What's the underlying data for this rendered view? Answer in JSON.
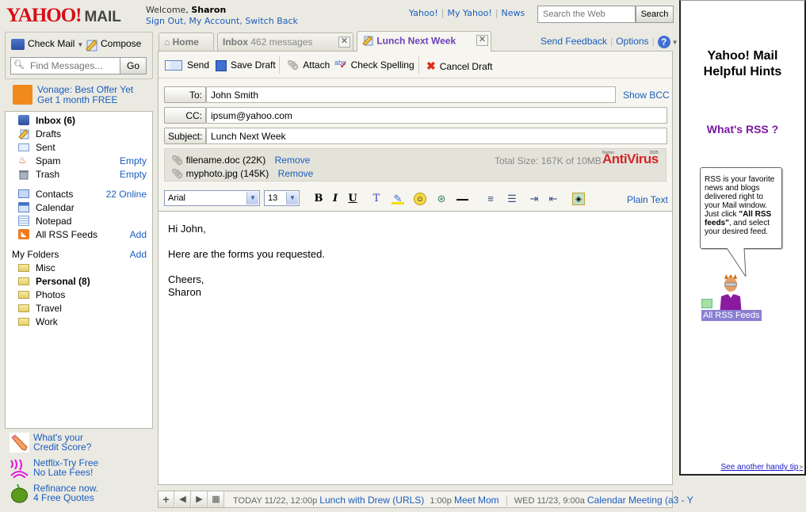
{
  "header": {
    "logo": "YAHOO!",
    "logo_suffix": "MAIL",
    "welcome_prefix": "Welcome, ",
    "user_name": "Sharon",
    "account_links": "Sign Out, My Account, Switch Back",
    "top_links": [
      "Yahoo!",
      "My Yahoo!",
      "News"
    ],
    "search_placeholder": "Search the Web",
    "search_button": "Search"
  },
  "left": {
    "check_mail": "Check Mail",
    "compose": "Compose",
    "find_placeholder": "Find Messages...",
    "go": "Go",
    "promo_line1": "Vonage: Best Offer Yet",
    "promo_line2": "Get 1 month FREE",
    "folders": [
      {
        "label": "Inbox (6)",
        "bold": true,
        "action": "",
        "icon": "inbox-icon"
      },
      {
        "label": "Drafts",
        "action": "",
        "icon": "drafts-icon"
      },
      {
        "label": "Sent",
        "action": "",
        "icon": "sent-icon"
      },
      {
        "label": "Spam",
        "action": "Empty",
        "icon": "spam-icon"
      },
      {
        "label": "Trash",
        "action": "Empty",
        "icon": "trash-icon"
      },
      {
        "label": "Contacts",
        "action": "22 Online",
        "icon": "contacts-icon"
      },
      {
        "label": "Calendar",
        "action": "",
        "icon": "calendar-icon"
      },
      {
        "label": "Notepad",
        "action": "",
        "icon": "notepad-icon"
      },
      {
        "label": "All RSS Feeds",
        "action": "Add",
        "icon": "rss-icon"
      }
    ],
    "my_folders_label": "My Folders",
    "my_folders_action": "Add",
    "my_folders": [
      {
        "label": "Misc"
      },
      {
        "label": "Personal (8)",
        "bold": true
      },
      {
        "label": "Photos"
      },
      {
        "label": "Travel"
      },
      {
        "label": "Work"
      }
    ],
    "ads": [
      {
        "line1": "What's your",
        "line2": "Credit Score?"
      },
      {
        "line1": "Netflix-Try Free",
        "line2": "No Late Fees!"
      },
      {
        "line1": "Refinance now.",
        "line2": "4 Free Quotes"
      }
    ]
  },
  "tabs": {
    "home": "Home",
    "inbox": "Inbox",
    "inbox_count": "462 messages",
    "compose": "Lunch Next Week",
    "close": "✕"
  },
  "top_right": {
    "feedback": "Send Feedback",
    "options": "Options",
    "help": "?"
  },
  "toolbar": {
    "send": "Send",
    "save_draft": "Save Draft",
    "attach": "Attach",
    "check_spelling": "Check Spelling",
    "cancel_draft": "Cancel Draft"
  },
  "compose": {
    "to_label": "To:",
    "to_value": "John Smith",
    "cc_label": "CC:",
    "cc_value": "ipsum@yahoo.com",
    "subject_label": "Subject:",
    "subject_value": "Lunch Next Week",
    "show_bcc": "Show BCC",
    "attachments": [
      {
        "name": "filename.doc (22K)",
        "action": "Remove"
      },
      {
        "name": "myphoto.jpg (145K)",
        "action": "Remove"
      }
    ],
    "total_size": "Total Size: 167K of 10MB",
    "antivirus_brand": "AntiVirus",
    "antivirus_small": "Norton",
    "antivirus_year": "2005",
    "font_family": "Arial",
    "font_size": "13",
    "plain_text": "Plain Text",
    "body_lines": [
      "Hi John,",
      "Here are the forms you requested.",
      "Cheers,",
      "Sharon"
    ]
  },
  "calendar_bar": {
    "today_label": "TODAY 11/22, 12:00p",
    "event1": "Lunch with Drew (URLS)",
    "time2": "1:00p",
    "event2": "Meet Mom",
    "wed_label": "WED 11/23, 9:00a",
    "event3": "Calendar Meeting (a3 - Y"
  },
  "hints": {
    "title_line1": "Yahoo! Mail",
    "title_line2": "Helpful Hints",
    "question": "What's RSS ?",
    "bubble_text_1": "RSS is your favorite news and blogs delivered right to your Mail window. Just click ",
    "bubble_bold": "\"All RSS feeds\"",
    "bubble_text_2": ", and select your desired feed.",
    "rss_label": "All RSS Feeds",
    "another_tip": "See another handy tip",
    "another_tip_arrow": ">"
  },
  "colors": {
    "accent_link": "#1a5dbf",
    "yahoo_red": "#d80c18",
    "active_tab": "#6a3fb8",
    "rss_question": "#7b189f",
    "background": "#ebeae2"
  }
}
